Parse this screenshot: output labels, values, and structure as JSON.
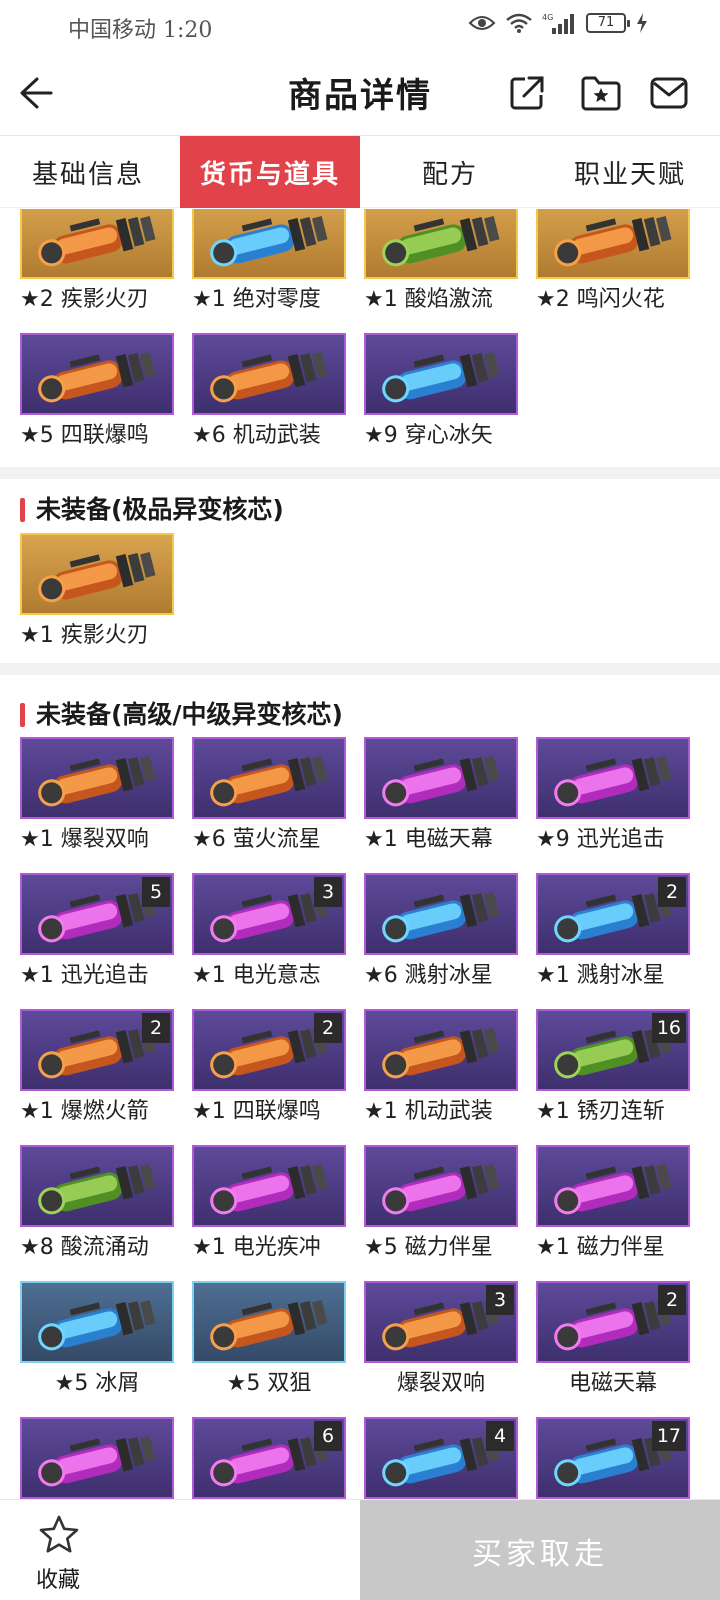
{
  "status": {
    "carrier_time": "中国移动 1:20",
    "battery": "71"
  },
  "header": {
    "title": "商品详情"
  },
  "tabs": [
    {
      "label": "基础信息"
    },
    {
      "label": "货币与道具"
    },
    {
      "label": "配方"
    },
    {
      "label": "职业天赋"
    }
  ],
  "equipped": {
    "items": [
      {
        "label": "★2 疾影火刃",
        "color": "gold"
      },
      {
        "label": "★1 绝对零度",
        "color": "gold"
      },
      {
        "label": "★1 酸焰激流",
        "color": "gold"
      },
      {
        "label": "★2 鸣闪火花",
        "color": "gold"
      },
      {
        "label": "★5 四联爆鸣",
        "color": "purple"
      },
      {
        "label": "★6 机动武装",
        "color": "purple"
      },
      {
        "label": "★9 穿心冰矢",
        "color": "purple"
      }
    ]
  },
  "section_premium": {
    "title": "未装备(极品异变核芯)",
    "items": [
      {
        "label": "★1 疾影火刃",
        "color": "gold"
      }
    ]
  },
  "section_high": {
    "title": "未装备(高级/中级异变核芯)",
    "items": [
      {
        "label": "★1 爆裂双响",
        "badge": ""
      },
      {
        "label": "★6 萤火流星",
        "badge": ""
      },
      {
        "label": "★1 电磁天幕",
        "badge": ""
      },
      {
        "label": "★9 迅光追击",
        "badge": ""
      },
      {
        "label": "★1 迅光追击",
        "badge": "5"
      },
      {
        "label": "★1 电光意志",
        "badge": "3"
      },
      {
        "label": "★6 溅射冰星",
        "badge": ""
      },
      {
        "label": "★1 溅射冰星",
        "badge": "2"
      },
      {
        "label": "★1 爆燃火箭",
        "badge": "2"
      },
      {
        "label": "★1 四联爆鸣",
        "badge": "2"
      },
      {
        "label": "★1 机动武装",
        "badge": ""
      },
      {
        "label": "★1 锈刃连斩",
        "badge": "16"
      },
      {
        "label": "★8 酸流涌动",
        "badge": ""
      },
      {
        "label": "★1 电光疾冲",
        "badge": ""
      },
      {
        "label": "★5 磁力伴星",
        "badge": ""
      },
      {
        "label": "★1 磁力伴星",
        "badge": ""
      },
      {
        "label": "★5 冰屑",
        "badge": ""
      },
      {
        "label": "★5 双狙",
        "badge": ""
      },
      {
        "label": "爆裂双响",
        "badge": "3"
      },
      {
        "label": "电磁天幕",
        "badge": "2"
      },
      {
        "label": "",
        "badge": ""
      },
      {
        "label": "",
        "badge": "6"
      },
      {
        "label": "",
        "badge": "4"
      },
      {
        "label": "",
        "badge": "17"
      }
    ]
  },
  "bottom": {
    "favorite_label": "收藏",
    "buy_label": "买家取走"
  }
}
